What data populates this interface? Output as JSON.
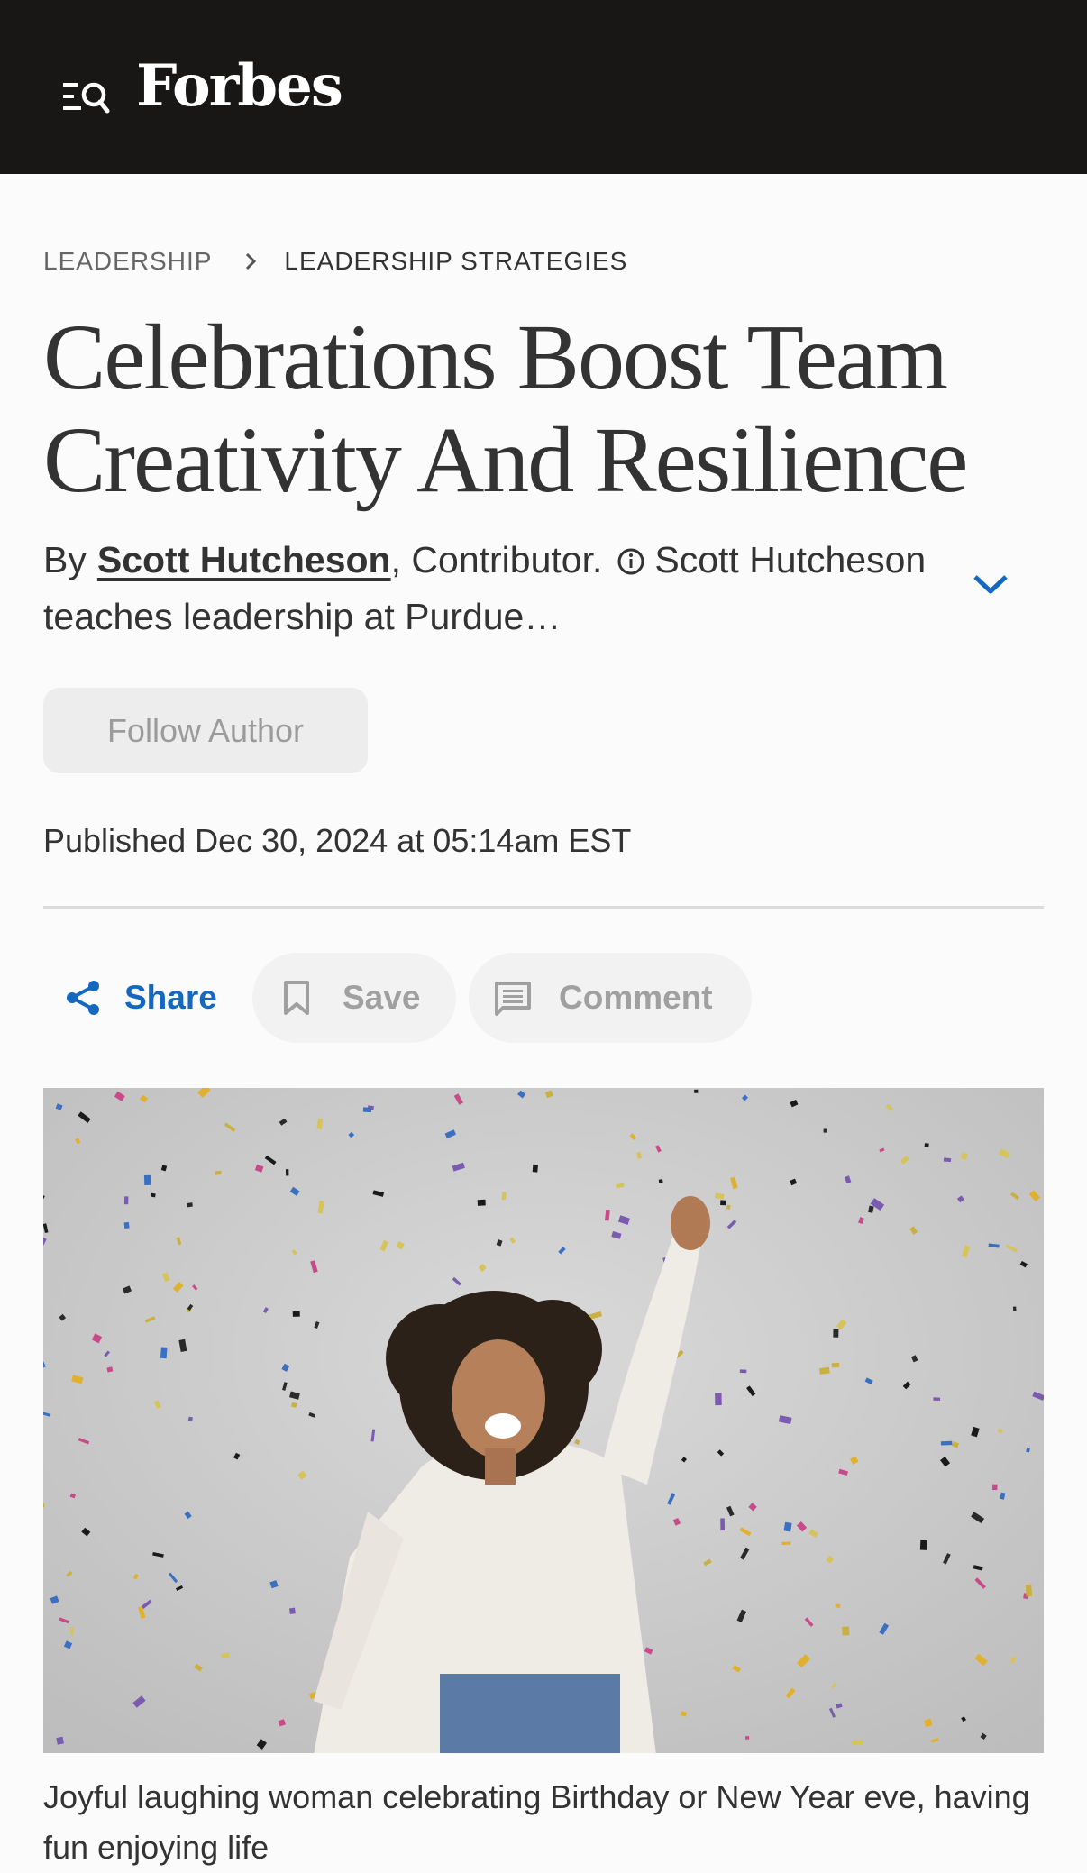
{
  "header": {
    "logo": "Forbes",
    "menu_icon": "menu-search-icon"
  },
  "breadcrumb": {
    "section": "LEADERSHIP",
    "subsection": "LEADERSHIP STRATEGIES"
  },
  "article": {
    "title": "Celebrations Boost Team Creativity And Resilience",
    "byline_prefix": "By",
    "author": "Scott Hutcheson",
    "author_suffix": ",",
    "author_role": "Contributor.",
    "author_bio": "Scott Hutcheson teaches leadership at Purdue…",
    "follow_label": "Follow Author",
    "published": "Published Dec 30, 2024 at 05:14am EST",
    "image_caption": "Joyful laughing woman celebrating Birthday or New Year eve, having fun enjoying life"
  },
  "actions": {
    "share_label": "Share",
    "save_label": "Save",
    "comment_label": "Comment"
  },
  "colors": {
    "header_bg": "#181716",
    "accent": "#1568c0",
    "button_bg": "#ededed"
  }
}
